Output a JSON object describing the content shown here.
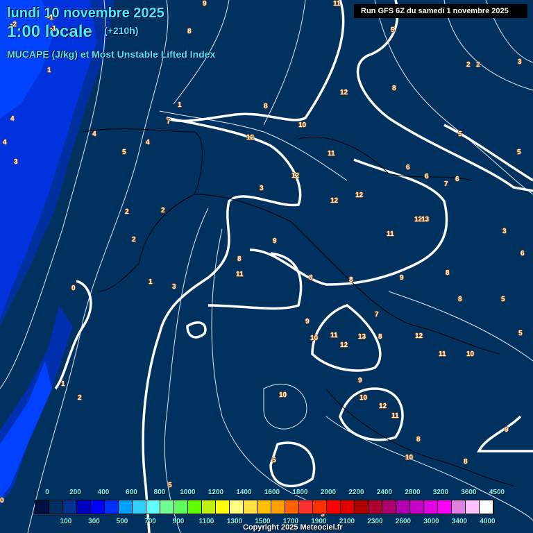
{
  "header": {
    "date": "lundi 10 novembre 2025",
    "time": "1:00 locale",
    "lead": "(+210h)",
    "parameter": "MUCAPE (J/kg) et Most Unstable Lifted Index",
    "run": "Run GFS 6Z du samedi 1 novembre 2025"
  },
  "map": {
    "background_color": "#00315f",
    "contour_labels": [
      "9",
      "11",
      "8",
      "-1",
      "-2",
      "-1",
      "1",
      "4",
      "4",
      "3",
      "4",
      "5",
      "4",
      "1",
      "7",
      "8",
      "12",
      "10",
      "12",
      "11",
      "12",
      "3",
      "12",
      "12",
      "2",
      "2",
      "2",
      "1",
      "3",
      "0",
      "8",
      "8",
      "11",
      "9",
      "8",
      "8",
      "12",
      "13",
      "11",
      "6",
      "6",
      "7",
      "6",
      "5",
      "5",
      "3",
      "2",
      "2",
      "3",
      "5",
      "6",
      "5",
      "8",
      "9",
      "8",
      "10",
      "9",
      "12",
      "11",
      "13",
      "12",
      "8",
      "11",
      "10",
      "9",
      "10",
      "12",
      "11",
      "10",
      "9",
      "8",
      "8",
      "10",
      "5",
      "5",
      "1",
      "2",
      "0",
      "9",
      "7",
      "5"
    ]
  },
  "colorbar": {
    "colors": [
      "#001040",
      "#003060",
      "#003090",
      "#0000c0",
      "#0000ff",
      "#0030ff",
      "#00a0ff",
      "#30d0ff",
      "#60ffff",
      "#70ff90",
      "#60ff60",
      "#60ff00",
      "#c0f010",
      "#ffff00",
      "#ffff80",
      "#ffe040",
      "#ffc000",
      "#ffa000",
      "#ff6000",
      "#ff3030",
      "#ff3000",
      "#ff0000",
      "#e00000",
      "#b00000",
      "#b00030",
      "#b00070",
      "#b000b0",
      "#c800c8",
      "#e000e0",
      "#ff00ff",
      "#e080e0",
      "#ffc0ff",
      "#ffffff"
    ],
    "top_labels": [
      "0",
      "200",
      "400",
      "600",
      "800",
      "1000",
      "1200",
      "1400",
      "1600",
      "1800",
      "2000",
      "2200",
      "2400",
      "2800",
      "3200",
      "3600",
      "4500"
    ],
    "bottom_labels": [
      "100",
      "300",
      "500",
      "700",
      "900",
      "1100",
      "1300",
      "1500",
      "1700",
      "1900",
      "2100",
      "2300",
      "2600",
      "3000",
      "3400",
      "4000"
    ]
  },
  "footer": {
    "copyright": "Copyright 2025 Meteociel.fr"
  }
}
